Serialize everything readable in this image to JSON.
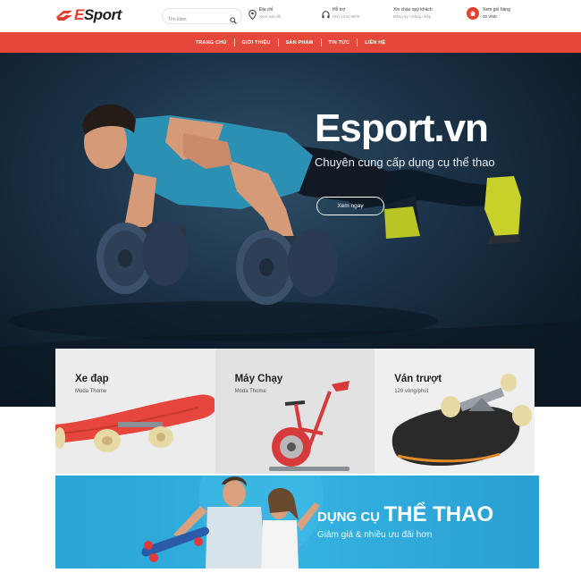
{
  "header": {
    "logo_text": "Sport",
    "logo_letter": "E",
    "search": {
      "placeholder": "Tìm kiếm"
    },
    "address": {
      "title": "Địa chỉ",
      "subtitle": "Xem bản đồ"
    },
    "support": {
      "title": "Hỗ trợ",
      "subtitle": "(84) 1234 5678"
    },
    "account": {
      "title": "Xin chào quý khách",
      "subtitle": "Đăng ký / Đăng nhập"
    },
    "cart": {
      "title": "Xem giỏ hàng",
      "subtitle": "00 VNĐ"
    }
  },
  "nav": {
    "items": [
      "TRANG CHỦ",
      "GIỚI THIỆU",
      "SẢN PHẨM",
      "TIN TỨC",
      "LIÊN HỆ"
    ]
  },
  "hero": {
    "title": "Esport.vn",
    "subtitle": "Chuyên cung cấp dụng cụ thể thao",
    "button": "Xem ngay"
  },
  "categories": [
    {
      "title": "Xe đạp",
      "subtitle": "Moda Thome"
    },
    {
      "title": "Máy Chạy",
      "subtitle": "Moda Thome"
    },
    {
      "title": "Ván trượt",
      "subtitle": "120 vòng/phút"
    }
  ],
  "promo": {
    "title_small": "DỤNG CỤ",
    "title_big": "THỂ THAO",
    "subtitle": "Giảm giá & nhiều ưu đãi hơn"
  },
  "colors": {
    "accent": "#e5473a",
    "hero_bg": "#1b3247",
    "promo_bg": "#33b2e0"
  }
}
